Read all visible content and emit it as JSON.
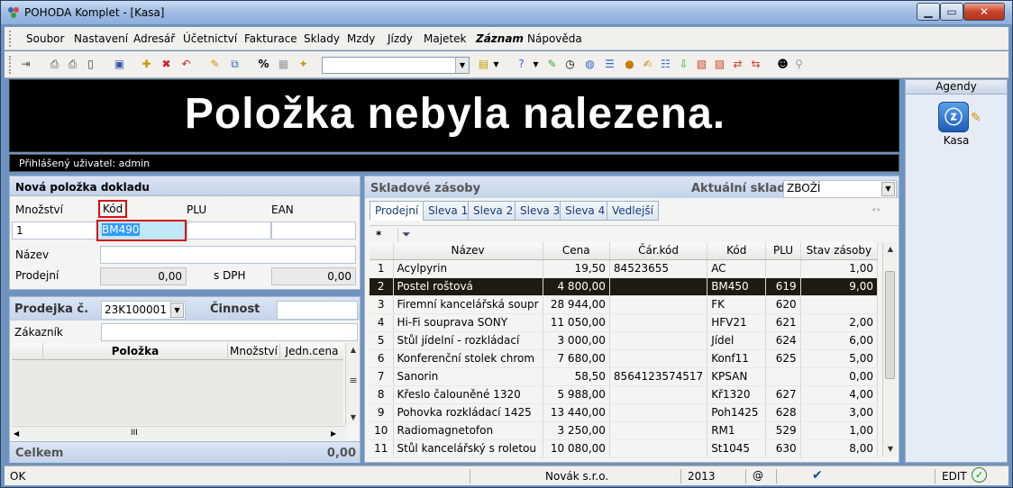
{
  "window": {
    "title": "POHODA Komplet - [Kasa]",
    "min": "▁",
    "max": "▭",
    "close": "✕"
  },
  "menu": [
    "Soubor",
    "Nastavení",
    "Adresář",
    "Účetnictví",
    "Fakturace",
    "Sklady",
    "Mzdy",
    "Jízdy",
    "Majetek",
    "Záznam",
    "Nápověda"
  ],
  "banner": {
    "message": "Položka nebyla nalezena.",
    "user": "Přihlášený uživatel: admin"
  },
  "new_item": {
    "title": "Nová položka dokladu",
    "labels": {
      "qty": "Množství",
      "code": "Kód",
      "plu": "PLU",
      "ean": "EAN",
      "name": "Název",
      "price": "Prodejní",
      "vat": "s DPH"
    },
    "values": {
      "qty": "1",
      "code": "BM490",
      "price": "0,00",
      "price_vat": "0,00"
    }
  },
  "receipt": {
    "label": "Prodejka č.",
    "number": "23K100001",
    "activity_label": "Činnost",
    "customer_label": "Zákazník",
    "columns": [
      "Položka",
      "Množství",
      "Jedn.cena"
    ],
    "total_label": "Celkem",
    "total": "0,00",
    "hscroll": "III"
  },
  "stock": {
    "title": "Skladové zásoby",
    "warehouse_label": "Aktuální sklad",
    "warehouse": "ZBOŽÍ",
    "tabs": [
      "Prodejní",
      "Sleva 1",
      "Sleva 2",
      "Sleva 3",
      "Sleva 4",
      "Vedlejší"
    ],
    "columns": [
      "Název",
      "Cena",
      "Čár.kód",
      "Kód",
      "PLU",
      "Stav zásoby"
    ],
    "rows": [
      {
        "idx": "1",
        "name": "Acylpyrin",
        "price": "19,50",
        "barcode": "84523655",
        "code": "AC",
        "plu": "",
        "stock": "1,00"
      },
      {
        "idx": "2",
        "name": "Postel roštová",
        "price": "4 800,00",
        "barcode": "",
        "code": "BM450",
        "plu": "619",
        "stock": "9,00"
      },
      {
        "idx": "3",
        "name": "Firemní kancelářská soupr",
        "price": "28 944,00",
        "barcode": "",
        "code": "FK",
        "plu": "620",
        "stock": ""
      },
      {
        "idx": "4",
        "name": "Hi-Fi souprava SONY",
        "price": "11 050,00",
        "barcode": "",
        "code": "HFV21",
        "plu": "621",
        "stock": "2,00"
      },
      {
        "idx": "5",
        "name": "Stůl jídelní - rozkládací",
        "price": "3 000,00",
        "barcode": "",
        "code": "Jídel",
        "plu": "624",
        "stock": "6,00"
      },
      {
        "idx": "6",
        "name": "Konferenční stolek chrom",
        "price": "7 680,00",
        "barcode": "",
        "code": "Konf11",
        "plu": "625",
        "stock": "5,00"
      },
      {
        "idx": "7",
        "name": "Sanorin",
        "price": "58,50",
        "barcode": "8564123574517",
        "code": "KPSAN",
        "plu": "",
        "stock": "0,00"
      },
      {
        "idx": "8",
        "name": "Křeslo čalouněné 1320",
        "price": "5 988,00",
        "barcode": "",
        "code": "Kř1320",
        "plu": "627",
        "stock": "4,00"
      },
      {
        "idx": "9",
        "name": "Pohovka rozkládací 1425",
        "price": "13 440,00",
        "barcode": "",
        "code": "Poh1425",
        "plu": "628",
        "stock": "3,00"
      },
      {
        "idx": "10",
        "name": "Radiomagnetofon",
        "price": "3 250,00",
        "barcode": "",
        "code": "RM1",
        "plu": "529",
        "stock": "1,00"
      },
      {
        "idx": "11",
        "name": "Stůl kancelářský s roletou",
        "price": "10 080,00",
        "barcode": "",
        "code": "St1045",
        "plu": "630",
        "stock": "8,00"
      }
    ],
    "selected_row": 2
  },
  "agendy": {
    "title": "Agendy",
    "item": "Kasa"
  },
  "status": {
    "left": "OK",
    "company": "Novák s.r.o.",
    "year": "2013",
    "at": "@",
    "mode": "EDIT"
  },
  "colors": {
    "accent": "#d81010",
    "selection": "#1e1b12",
    "banner_bg": "#000000"
  }
}
